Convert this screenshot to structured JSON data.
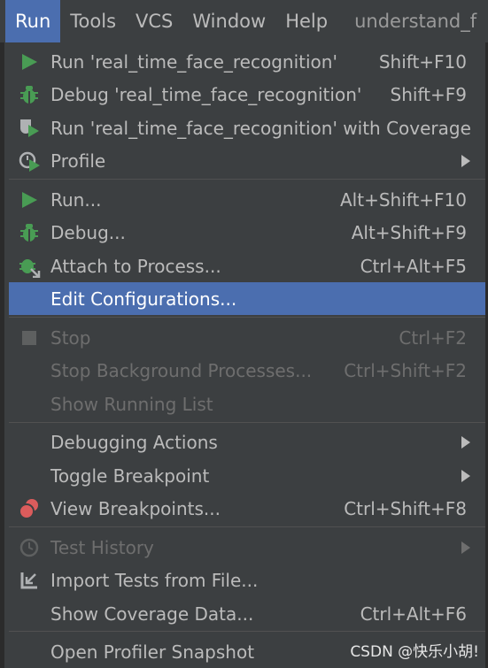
{
  "menubar": {
    "items": [
      "Run",
      "Tools",
      "VCS",
      "Window",
      "Help"
    ],
    "title": "understand_f"
  },
  "menu": {
    "items": [
      {
        "label": "Run 'real_time_face_recognition'",
        "shortcut": "Shift+F10",
        "icon": "run-icon"
      },
      {
        "label": "Debug 'real_time_face_recognition'",
        "shortcut": "Shift+F9",
        "icon": "debug-icon"
      },
      {
        "label": "Run 'real_time_face_recognition' with Coverage",
        "shortcut": "",
        "icon": "coverage-icon"
      },
      {
        "label": "Profile",
        "shortcut": "",
        "icon": "profile-icon",
        "submenu": true
      },
      {
        "label": "Run...",
        "shortcut": "Alt+Shift+F10",
        "icon": "run-icon"
      },
      {
        "label": "Debug...",
        "shortcut": "Alt+Shift+F9",
        "icon": "debug-icon"
      },
      {
        "label": "Attach to Process...",
        "shortcut": "Ctrl+Alt+F5",
        "icon": "attach-process-icon"
      },
      {
        "label": "Edit Configurations...",
        "shortcut": "",
        "icon": "",
        "selected": true
      },
      {
        "label": "Stop",
        "shortcut": "Ctrl+F2",
        "icon": "stop-icon",
        "disabled": true
      },
      {
        "label": "Stop Background Processes...",
        "shortcut": "Ctrl+Shift+F2",
        "icon": "",
        "disabled": true
      },
      {
        "label": "Show Running List",
        "shortcut": "",
        "icon": "",
        "disabled": true
      },
      {
        "label": "Debugging Actions",
        "shortcut": "",
        "icon": "",
        "submenu": true
      },
      {
        "label": "Toggle Breakpoint",
        "shortcut": "",
        "icon": "",
        "submenu": true
      },
      {
        "label": "View Breakpoints...",
        "shortcut": "Ctrl+Shift+F8",
        "icon": "breakpoints-icon"
      },
      {
        "label": "Test History",
        "shortcut": "",
        "icon": "history-icon",
        "disabled": true,
        "submenu": true
      },
      {
        "label": "Import Tests from File...",
        "shortcut": "",
        "icon": "import-icon"
      },
      {
        "label": "Show Coverage Data...",
        "shortcut": "Ctrl+Alt+F6",
        "icon": ""
      },
      {
        "label": "Open Profiler Snapshot",
        "shortcut": "",
        "icon": ""
      }
    ]
  },
  "watermark": "CSDN @快乐小胡!",
  "colors": {
    "accent": "#4b6eaf",
    "run_green": "#499c54",
    "breakpoint_red": "#db5c5c"
  }
}
